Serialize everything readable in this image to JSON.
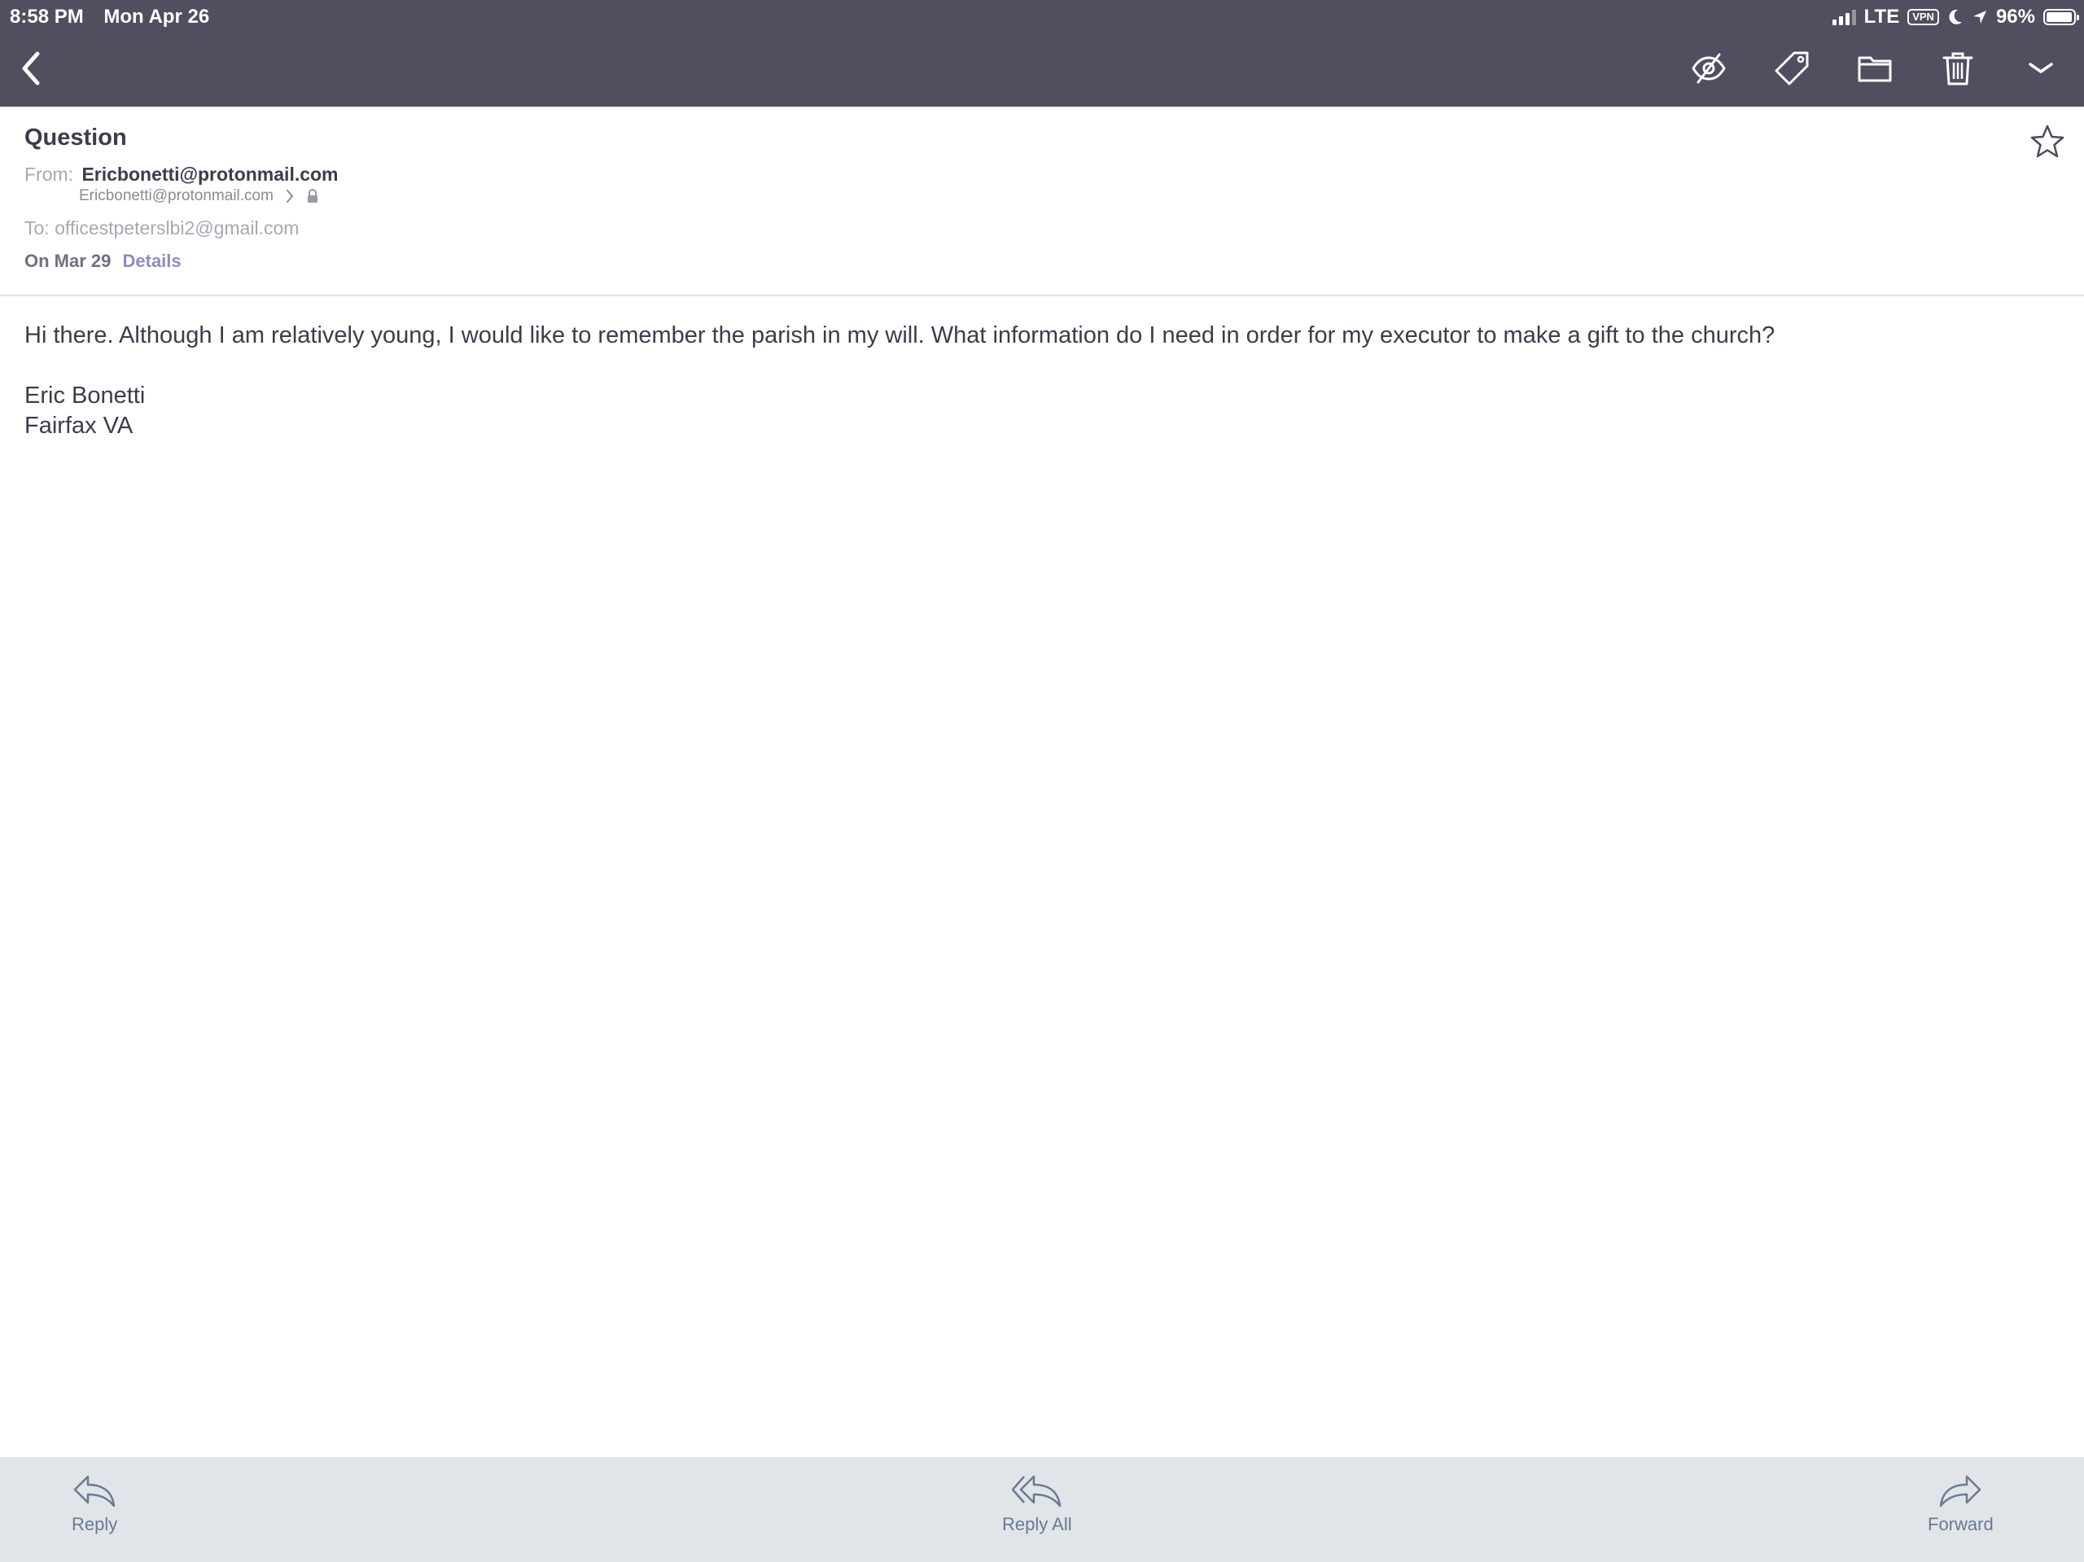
{
  "status_bar": {
    "time": "8:58 PM",
    "date": "Mon Apr 26",
    "network": "LTE",
    "vpn": "VPN",
    "battery": "96%",
    "battery_level": 0.96
  },
  "nav": {
    "back_icon": "chevron-left-icon",
    "actions": [
      {
        "name": "mark-unread-button",
        "icon": "eye-slash-icon"
      },
      {
        "name": "label-button",
        "icon": "tag-icon"
      },
      {
        "name": "move-folder-button",
        "icon": "folder-icon"
      },
      {
        "name": "trash-button",
        "icon": "trash-icon"
      },
      {
        "name": "more-button",
        "icon": "chevron-down-icon"
      }
    ]
  },
  "message": {
    "subject": "Question",
    "from_label": "From:",
    "from_name": "Ericbonetti@protonmail.com",
    "from_address": "Ericbonetti@protonmail.com",
    "to_line": "To: officestpeterslbi2@gmail.com",
    "date": "On Mar 29",
    "details_link": "Details",
    "body": "Hi there. Although I am relatively young, I would like to remember the parish in my will. What information do I need in order for my executor to make a gift to the church?",
    "signature_name": "Eric Bonetti",
    "signature_location": "Fairfax VA"
  },
  "toolbar": {
    "reply": "Reply",
    "reply_all": "Reply All",
    "forward": "Forward"
  },
  "colors": {
    "header_bg": "#4f4f5f",
    "bottom_bg": "#e1e5ea",
    "link": "#8c8cc0",
    "text": "#3c3c4c"
  }
}
